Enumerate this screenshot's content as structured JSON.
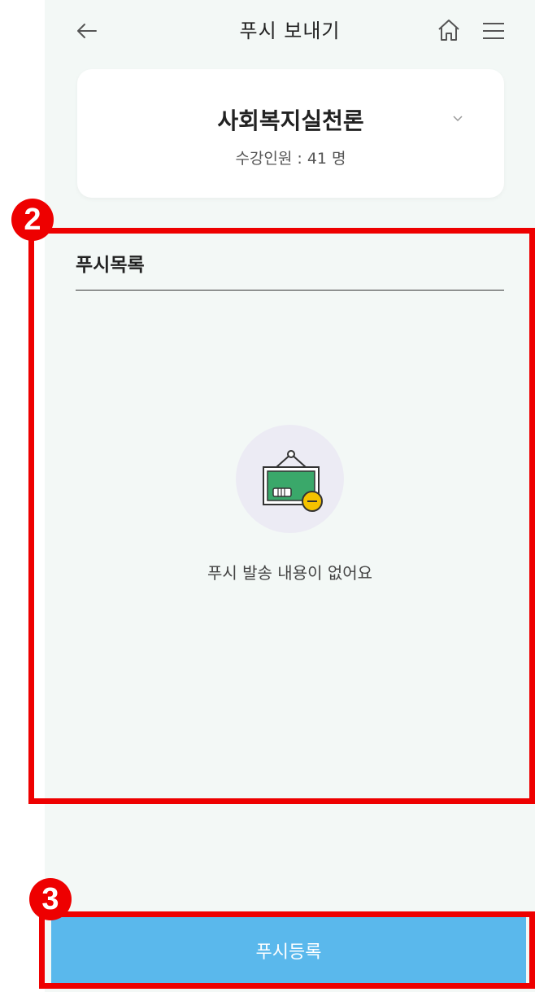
{
  "header": {
    "title": "푸시 보내기",
    "back_icon": "arrow-left-icon",
    "home_icon": "home-icon",
    "menu_icon": "hamburger-menu-icon"
  },
  "course": {
    "name": "사회복지실천론",
    "meta": "수강인원 : 41 명",
    "dropdown_icon": "chevron-down-icon"
  },
  "push_list": {
    "title": "푸시목록",
    "empty_icon": "empty-board-icon",
    "empty_text": "푸시 발송 내용이 없어요"
  },
  "footer": {
    "register_label": "푸시등록"
  },
  "annotations": [
    {
      "label": "2",
      "color": "#ee0000"
    },
    {
      "label": "3",
      "color": "#ee0000"
    }
  ],
  "colors": {
    "background": "#f3f8f6",
    "accent": "#5ab8ec",
    "annotation": "#ee0000"
  }
}
